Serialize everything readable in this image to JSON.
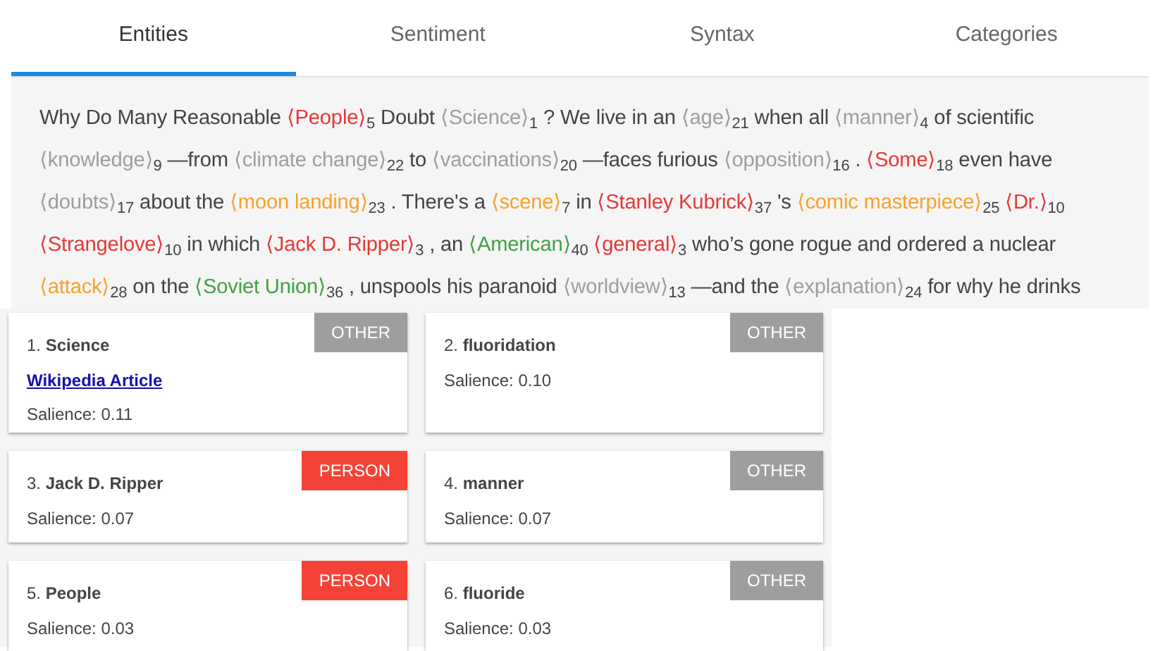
{
  "tabs": [
    {
      "label": "Entities",
      "selected": true
    },
    {
      "label": "Sentiment",
      "selected": false
    },
    {
      "label": "Syntax",
      "selected": false
    },
    {
      "label": "Categories",
      "selected": false
    }
  ],
  "passage": [
    [
      {
        "kind": "text",
        "text": "Why Do Many Reasonable"
      },
      {
        "kind": "entity",
        "text": "⟨People⟩",
        "index": "5",
        "color": "#e53935"
      },
      {
        "kind": "text",
        "text": "Doubt"
      },
      {
        "kind": "entity",
        "text": "⟨Science⟩",
        "index": "1",
        "color": "#9e9e9e"
      },
      {
        "kind": "text",
        "text": "? We live in an"
      },
      {
        "kind": "entity",
        "text": "⟨age⟩",
        "index": "21",
        "color": "#9e9e9e"
      },
      {
        "kind": "text",
        "text": "when all"
      },
      {
        "kind": "entity",
        "text": "⟨manner⟩",
        "index": "4",
        "color": "#9e9e9e"
      },
      {
        "kind": "text",
        "text": "of scientific"
      }
    ],
    [
      {
        "kind": "entity",
        "text": "⟨knowledge⟩",
        "index": "9",
        "color": "#9e9e9e"
      },
      {
        "kind": "text",
        "text": "—from"
      },
      {
        "kind": "entity",
        "text": "⟨climate change⟩",
        "index": "22",
        "color": "#9e9e9e"
      },
      {
        "kind": "text",
        "text": "to"
      },
      {
        "kind": "entity",
        "text": "⟨vaccinations⟩",
        "index": "20",
        "color": "#9e9e9e"
      },
      {
        "kind": "text",
        "text": "—faces furious"
      },
      {
        "kind": "entity",
        "text": "⟨opposition⟩",
        "index": "16",
        "color": "#9e9e9e"
      },
      {
        "kind": "text",
        "text": "."
      },
      {
        "kind": "entity",
        "text": "⟨Some⟩",
        "index": "18",
        "color": "#e53935"
      },
      {
        "kind": "text",
        "text": "even have"
      }
    ],
    [
      {
        "kind": "entity",
        "text": "⟨doubts⟩",
        "index": "17",
        "color": "#9e9e9e"
      },
      {
        "kind": "text",
        "text": "about the"
      },
      {
        "kind": "entity",
        "text": "⟨moon landing⟩",
        "index": "23",
        "color": "#f6a22d"
      },
      {
        "kind": "text",
        "text": ". There's a"
      },
      {
        "kind": "entity",
        "text": "⟨scene⟩",
        "index": "7",
        "color": "#f6a22d"
      },
      {
        "kind": "text",
        "text": "in"
      },
      {
        "kind": "entity",
        "text": "⟨Stanley Kubrick⟩",
        "index": "37",
        "color": "#e53935"
      },
      {
        "kind": "text",
        "text": "'s"
      },
      {
        "kind": "entity",
        "text": "⟨comic masterpiece⟩",
        "index": "25",
        "color": "#f6a22d"
      },
      {
        "kind": "entity",
        "text": "⟨Dr.⟩",
        "index": "10",
        "color": "#e53935"
      }
    ],
    [
      {
        "kind": "entity",
        "text": "⟨Strangelove⟩",
        "index": "10",
        "color": "#e53935"
      },
      {
        "kind": "text",
        "text": "in which"
      },
      {
        "kind": "entity",
        "text": "⟨Jack D. Ripper⟩",
        "index": "3",
        "color": "#e53935"
      },
      {
        "kind": "text",
        "text": ", an"
      },
      {
        "kind": "entity",
        "text": "⟨American⟩",
        "index": "40",
        "color": "#43a047"
      },
      {
        "kind": "entity",
        "text": "⟨general⟩",
        "index": "3",
        "color": "#e53935"
      },
      {
        "kind": "text",
        "text": "who’s gone rogue and ordered a nuclear"
      }
    ],
    [
      {
        "kind": "entity",
        "text": "⟨attack⟩",
        "index": "28",
        "color": "#f6a22d"
      },
      {
        "kind": "text",
        "text": "on the"
      },
      {
        "kind": "entity",
        "text": "⟨Soviet Union⟩",
        "index": "36",
        "color": "#43a047"
      },
      {
        "kind": "text",
        "text": ", unspools his paranoid"
      },
      {
        "kind": "entity",
        "text": "⟨worldview⟩",
        "index": "13",
        "color": "#9e9e9e"
      },
      {
        "kind": "text",
        "text": "—and the"
      },
      {
        "kind": "entity",
        "text": "⟨explanation⟩",
        "index": "24",
        "color": "#9e9e9e"
      },
      {
        "kind": "text",
        "text": "for why he drinks"
      }
    ]
  ],
  "entities": [
    {
      "title": "1. **Science**",
      "type": "OTHER",
      "kind": "other",
      "link": "Wikipedia Article",
      "salience": "Salience: 0.11"
    },
    {
      "title": "2. **fluoridation**",
      "type": "OTHER",
      "kind": "other",
      "salience": "Salience: 0.10"
    },
    {
      "title": "3. **Jack D. Ripper**",
      "type": "PERSON",
      "kind": "person",
      "salience": "Salience: 0.07"
    },
    {
      "title": "4. **manner**",
      "type": "OTHER",
      "kind": "other",
      "salience": "Salience: 0.07"
    },
    {
      "title": "5. **People**",
      "type": "PERSON",
      "kind": "person",
      "salience": "Salience: 0.03"
    },
    {
      "title": "6. **fluoride**",
      "type": "OTHER",
      "kind": "other",
      "salience": "Salience: 0.03"
    }
  ]
}
